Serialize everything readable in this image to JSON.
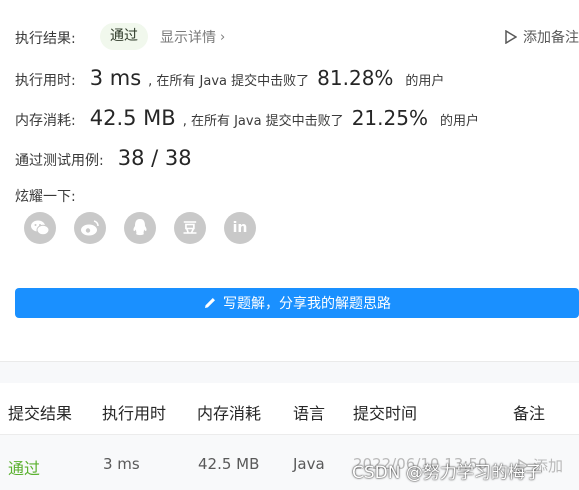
{
  "result": {
    "status_label": "执行结果:",
    "status_value": "通过",
    "detail_link": "显示详情",
    "add_note": "添加备注",
    "runtime_label": "执行用时:",
    "runtime_value": "3 ms",
    "runtime_mid": ", 在所有 Java 提交中击败了",
    "runtime_pct": "81.28%",
    "runtime_tail": "的用户",
    "memory_label": "内存消耗:",
    "memory_value": "42.5 MB",
    "memory_mid": ", 在所有 Java 提交中击败了",
    "memory_pct": "21.25%",
    "memory_tail": "的用户",
    "tests_label": "通过测试用例:",
    "tests_value": "38 / 38"
  },
  "share": {
    "title": "炫耀一下:",
    "icons": [
      "wechat-icon",
      "weibo-icon",
      "qq-icon",
      "douban-icon",
      "linkedin-icon"
    ],
    "douban_glyph": "豆",
    "linkedin_glyph": "in"
  },
  "solution_button": "写题解，分享我的解题思路",
  "table": {
    "headers": [
      "提交结果",
      "执行用时",
      "内存消耗",
      "语言",
      "提交时间",
      "备注"
    ],
    "row": {
      "result": "通过",
      "runtime": "3 ms",
      "memory": "42.5 MB",
      "language": "Java",
      "time": "2022/06/10 13:50",
      "note": "添加"
    }
  },
  "watermark": "CSDN @努力学习的梅子",
  "colors": {
    "accent": "#1a90ff",
    "success": "#5bb130",
    "icon_gray": "#c9c9c9"
  }
}
